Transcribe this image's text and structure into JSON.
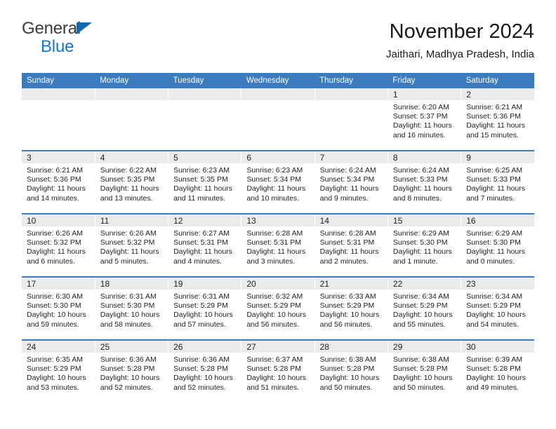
{
  "brand": {
    "name_part1": "General",
    "name_part2": "Blue",
    "flag_color": "#1169b0"
  },
  "header": {
    "title": "November 2024",
    "subtitle": "Jaithari, Madhya Pradesh, India"
  },
  "theme": {
    "header_blue": "#3a7cbe",
    "daynum_band": "#ebebeb",
    "text": "#222222"
  },
  "weekday_headers": [
    "Sunday",
    "Monday",
    "Tuesday",
    "Wednesday",
    "Thursday",
    "Friday",
    "Saturday"
  ],
  "weeks": [
    [
      {
        "day": "",
        "empty": true
      },
      {
        "day": "",
        "empty": true
      },
      {
        "day": "",
        "empty": true
      },
      {
        "day": "",
        "empty": true
      },
      {
        "day": "",
        "empty": true
      },
      {
        "day": "1",
        "sunrise": "Sunrise: 6:20 AM",
        "sunset": "Sunset: 5:37 PM",
        "daylight": "Daylight: 11 hours and 16 minutes."
      },
      {
        "day": "2",
        "sunrise": "Sunrise: 6:21 AM",
        "sunset": "Sunset: 5:36 PM",
        "daylight": "Daylight: 11 hours and 15 minutes."
      }
    ],
    [
      {
        "day": "3",
        "sunrise": "Sunrise: 6:21 AM",
        "sunset": "Sunset: 5:36 PM",
        "daylight": "Daylight: 11 hours and 14 minutes."
      },
      {
        "day": "4",
        "sunrise": "Sunrise: 6:22 AM",
        "sunset": "Sunset: 5:35 PM",
        "daylight": "Daylight: 11 hours and 13 minutes."
      },
      {
        "day": "5",
        "sunrise": "Sunrise: 6:23 AM",
        "sunset": "Sunset: 5:35 PM",
        "daylight": "Daylight: 11 hours and 11 minutes."
      },
      {
        "day": "6",
        "sunrise": "Sunrise: 6:23 AM",
        "sunset": "Sunset: 5:34 PM",
        "daylight": "Daylight: 11 hours and 10 minutes."
      },
      {
        "day": "7",
        "sunrise": "Sunrise: 6:24 AM",
        "sunset": "Sunset: 5:34 PM",
        "daylight": "Daylight: 11 hours and 9 minutes."
      },
      {
        "day": "8",
        "sunrise": "Sunrise: 6:24 AM",
        "sunset": "Sunset: 5:33 PM",
        "daylight": "Daylight: 11 hours and 8 minutes."
      },
      {
        "day": "9",
        "sunrise": "Sunrise: 6:25 AM",
        "sunset": "Sunset: 5:33 PM",
        "daylight": "Daylight: 11 hours and 7 minutes."
      }
    ],
    [
      {
        "day": "10",
        "sunrise": "Sunrise: 6:26 AM",
        "sunset": "Sunset: 5:32 PM",
        "daylight": "Daylight: 11 hours and 6 minutes."
      },
      {
        "day": "11",
        "sunrise": "Sunrise: 6:26 AM",
        "sunset": "Sunset: 5:32 PM",
        "daylight": "Daylight: 11 hours and 5 minutes."
      },
      {
        "day": "12",
        "sunrise": "Sunrise: 6:27 AM",
        "sunset": "Sunset: 5:31 PM",
        "daylight": "Daylight: 11 hours and 4 minutes."
      },
      {
        "day": "13",
        "sunrise": "Sunrise: 6:28 AM",
        "sunset": "Sunset: 5:31 PM",
        "daylight": "Daylight: 11 hours and 3 minutes."
      },
      {
        "day": "14",
        "sunrise": "Sunrise: 6:28 AM",
        "sunset": "Sunset: 5:31 PM",
        "daylight": "Daylight: 11 hours and 2 minutes."
      },
      {
        "day": "15",
        "sunrise": "Sunrise: 6:29 AM",
        "sunset": "Sunset: 5:30 PM",
        "daylight": "Daylight: 11 hours and 1 minute."
      },
      {
        "day": "16",
        "sunrise": "Sunrise: 6:29 AM",
        "sunset": "Sunset: 5:30 PM",
        "daylight": "Daylight: 11 hours and 0 minutes."
      }
    ],
    [
      {
        "day": "17",
        "sunrise": "Sunrise: 6:30 AM",
        "sunset": "Sunset: 5:30 PM",
        "daylight": "Daylight: 10 hours and 59 minutes."
      },
      {
        "day": "18",
        "sunrise": "Sunrise: 6:31 AM",
        "sunset": "Sunset: 5:30 PM",
        "daylight": "Daylight: 10 hours and 58 minutes."
      },
      {
        "day": "19",
        "sunrise": "Sunrise: 6:31 AM",
        "sunset": "Sunset: 5:29 PM",
        "daylight": "Daylight: 10 hours and 57 minutes."
      },
      {
        "day": "20",
        "sunrise": "Sunrise: 6:32 AM",
        "sunset": "Sunset: 5:29 PM",
        "daylight": "Daylight: 10 hours and 56 minutes."
      },
      {
        "day": "21",
        "sunrise": "Sunrise: 6:33 AM",
        "sunset": "Sunset: 5:29 PM",
        "daylight": "Daylight: 10 hours and 56 minutes."
      },
      {
        "day": "22",
        "sunrise": "Sunrise: 6:34 AM",
        "sunset": "Sunset: 5:29 PM",
        "daylight": "Daylight: 10 hours and 55 minutes."
      },
      {
        "day": "23",
        "sunrise": "Sunrise: 6:34 AM",
        "sunset": "Sunset: 5:29 PM",
        "daylight": "Daylight: 10 hours and 54 minutes."
      }
    ],
    [
      {
        "day": "24",
        "sunrise": "Sunrise: 6:35 AM",
        "sunset": "Sunset: 5:29 PM",
        "daylight": "Daylight: 10 hours and 53 minutes."
      },
      {
        "day": "25",
        "sunrise": "Sunrise: 6:36 AM",
        "sunset": "Sunset: 5:28 PM",
        "daylight": "Daylight: 10 hours and 52 minutes."
      },
      {
        "day": "26",
        "sunrise": "Sunrise: 6:36 AM",
        "sunset": "Sunset: 5:28 PM",
        "daylight": "Daylight: 10 hours and 52 minutes."
      },
      {
        "day": "27",
        "sunrise": "Sunrise: 6:37 AM",
        "sunset": "Sunset: 5:28 PM",
        "daylight": "Daylight: 10 hours and 51 minutes."
      },
      {
        "day": "28",
        "sunrise": "Sunrise: 6:38 AM",
        "sunset": "Sunset: 5:28 PM",
        "daylight": "Daylight: 10 hours and 50 minutes."
      },
      {
        "day": "29",
        "sunrise": "Sunrise: 6:38 AM",
        "sunset": "Sunset: 5:28 PM",
        "daylight": "Daylight: 10 hours and 50 minutes."
      },
      {
        "day": "30",
        "sunrise": "Sunrise: 6:39 AM",
        "sunset": "Sunset: 5:28 PM",
        "daylight": "Daylight: 10 hours and 49 minutes."
      }
    ]
  ]
}
